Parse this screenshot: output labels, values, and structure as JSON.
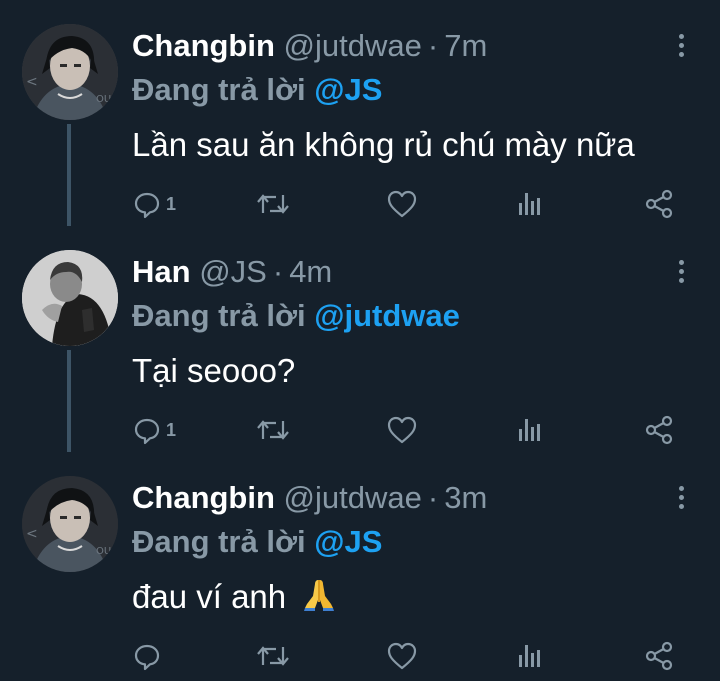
{
  "tweets": [
    {
      "name": "Changbin",
      "handle": "@jutdwae",
      "separator": "·",
      "time": "7m",
      "reply_prefix": "Đang trả lời",
      "reply_to": "@JS",
      "text": "Lần sau ăn không rủ chú mày nữa",
      "emoji": "",
      "reply_count": "1",
      "avatar": "changbin-avatar"
    },
    {
      "name": "Han",
      "handle": "@JS",
      "separator": "·",
      "time": "4m",
      "reply_prefix": "Đang trả lời",
      "reply_to": "@jutdwae",
      "text": "Tại seooo?",
      "emoji": "",
      "reply_count": "1",
      "avatar": "han-avatar"
    },
    {
      "name": "Changbin",
      "handle": "@jutdwae",
      "separator": "·",
      "time": "3m",
      "reply_prefix": "Đang trả lời",
      "reply_to": "@JS",
      "text": "đau ví anh",
      "emoji": "folded-hands",
      "reply_count": "",
      "avatar": "changbin-avatar"
    }
  ],
  "icons": {
    "reply": "reply-icon",
    "retweet": "retweet-icon",
    "like": "like-icon",
    "stats": "stats-icon",
    "share": "share-icon",
    "more": "more-options-icon"
  },
  "colors": {
    "background": "#15202b",
    "text": "#ffffff",
    "muted": "#8899a6",
    "accent": "#1da1f2",
    "thread_line": "#3d5466"
  }
}
